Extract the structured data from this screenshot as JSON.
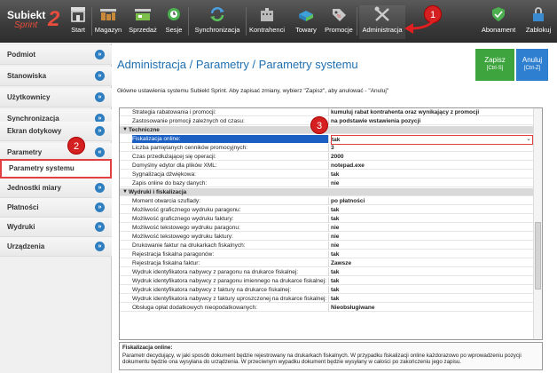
{
  "app": {
    "logo_text": "Subiekt",
    "logo_sub": "Sprint",
    "logo_num": "2"
  },
  "toolbar": {
    "items": [
      {
        "label": "Start",
        "icon": "store-icon"
      },
      {
        "label": "Magazyn",
        "icon": "warehouse-icon"
      },
      {
        "label": "Sprzedaż",
        "icon": "cash-register-icon"
      },
      {
        "label": "Sesje",
        "icon": "clock-icon"
      },
      {
        "label": "Synchronizacja",
        "icon": "sync-icon"
      },
      {
        "label": "Kontrahenci",
        "icon": "building-icon"
      },
      {
        "label": "Towary",
        "icon": "boxes-icon"
      },
      {
        "label": "Promocje",
        "icon": "tag-icon"
      },
      {
        "label": "Administracja",
        "icon": "tools-icon"
      },
      {
        "label": "Abonament",
        "icon": "shield-check-icon"
      },
      {
        "label": "Zablokuj",
        "icon": "lock-icon"
      }
    ]
  },
  "badges": {
    "b1": "1",
    "b2": "2",
    "b3": "3"
  },
  "sidebar": {
    "items": [
      {
        "label": "Podmiot",
        "chev": "»"
      },
      {
        "label": "Stanowiska",
        "chev": "»"
      },
      {
        "label": "Użytkownicy",
        "chev": "»"
      },
      {
        "label": "Synchronizacja",
        "chev": "»"
      },
      {
        "label": "Ekran dotykowy",
        "chev": "»"
      },
      {
        "label": "Parametry",
        "chev": "«"
      },
      {
        "label": "Parametry systemu",
        "chev": ""
      },
      {
        "label": "Jednostki miary",
        "chev": "»"
      },
      {
        "label": "Płatności",
        "chev": "»"
      },
      {
        "label": "Wydruki",
        "chev": "»"
      },
      {
        "label": "Urządzenia",
        "chev": "»"
      }
    ]
  },
  "main": {
    "title": "Administracja / Parametry / Parametry systemu",
    "subtitle": "Główne ustawienia systemu Subiekt Sprint. Aby zapisać zmiany, wybierz \"Zapisz\", aby anulować - \"Anuluj\"",
    "save_label": "Zapisz",
    "save_shortcut": "[Ctrl-S]",
    "cancel_label": "Anuluj",
    "cancel_shortcut": "[Ctrl-Z]"
  },
  "grid": {
    "rows": [
      {
        "type": "row",
        "k": "Strategia rabatowania i promocji:",
        "v": "kumuluj rabat kontrahenta oraz wynikający z promocji"
      },
      {
        "type": "row",
        "k": "Zastosowanie promocji zależnych od czasu:",
        "v": "na podstawie wstawienia pozycji"
      },
      {
        "type": "group",
        "k": "Techniczne"
      },
      {
        "type": "hl",
        "k": "Fiskalizacja online:",
        "v": "tak"
      },
      {
        "type": "row",
        "k": "Liczba pamiętanych cenników promocyjnych:",
        "v": "3"
      },
      {
        "type": "row",
        "k": "Czas przedłużającej się operacji:",
        "v": "2000"
      },
      {
        "type": "row",
        "k": "Domyślny edytor dla plików XML:",
        "v": "notepad.exe"
      },
      {
        "type": "row",
        "k": "Sygnalizacja dźwiękowa:",
        "v": "tak"
      },
      {
        "type": "row",
        "k": "Zapis online do bazy danych:",
        "v": "nie"
      },
      {
        "type": "group",
        "k": "Wydruki i fiskalizacja"
      },
      {
        "type": "row",
        "k": "Moment otwarcia szuflady:",
        "v": "po płatności"
      },
      {
        "type": "row",
        "k": "Możliwość graficznego wydruku paragonu:",
        "v": "tak"
      },
      {
        "type": "row",
        "k": "Możliwość graficznego wydruku faktury:",
        "v": "tak"
      },
      {
        "type": "row",
        "k": "Możliwość tekstowego wydruku paragonu:",
        "v": "nie"
      },
      {
        "type": "row",
        "k": "Możliwość tekstowego wydruku faktury:",
        "v": "nie"
      },
      {
        "type": "row",
        "k": "Drukowanie faktur na drukarkach fiskalnych:",
        "v": "nie"
      },
      {
        "type": "row",
        "k": "Rejestracja fiskalna paragonów:",
        "v": "tak"
      },
      {
        "type": "row",
        "k": "Rejestracja fiskalna faktur:",
        "v": "Zawsze"
      },
      {
        "type": "row",
        "k": "Wydruk identyfikatora nabywcy z paragonu na drukarce fiskalnej:",
        "v": "tak"
      },
      {
        "type": "row",
        "k": "Wydruk identyfikatora nabywcy z paragonu imiennego na drukarce fiskalnej:",
        "v": "tak"
      },
      {
        "type": "row",
        "k": "Wydruk identyfikatora nabywcy z faktury na drukarce fiskalnej:",
        "v": "tak"
      },
      {
        "type": "row",
        "k": "Wydruk identyfikatora nabywcy z faktury uproszczonej na drukarce fiskalnej:",
        "v": "tak"
      },
      {
        "type": "row",
        "k": "Obsługa opłat dodatkowych nieopodatkowanych:",
        "v": "Nieobsługiwane"
      }
    ],
    "dropdown_arrow": "⌄"
  },
  "help": {
    "title": "Fiskalizacja online:",
    "text": "Parametr decydujący, w jaki sposób dokument będzie rejestrowany na drukarkach fiskalnych. W przypadku fiskalizacji online każdorazowo po wprowadzeniu pozycji dokumentu będzie ona wysyłana do urządzenia. W przeciwnym wypadku dokument będzie wysyłany w całości po zakończeniu jego zapisu."
  },
  "colors": {
    "accent": "#1f6fb0",
    "save_bg": "#3ea43e",
    "cancel_bg": "#2f7fd0",
    "badge": "#d42020"
  }
}
